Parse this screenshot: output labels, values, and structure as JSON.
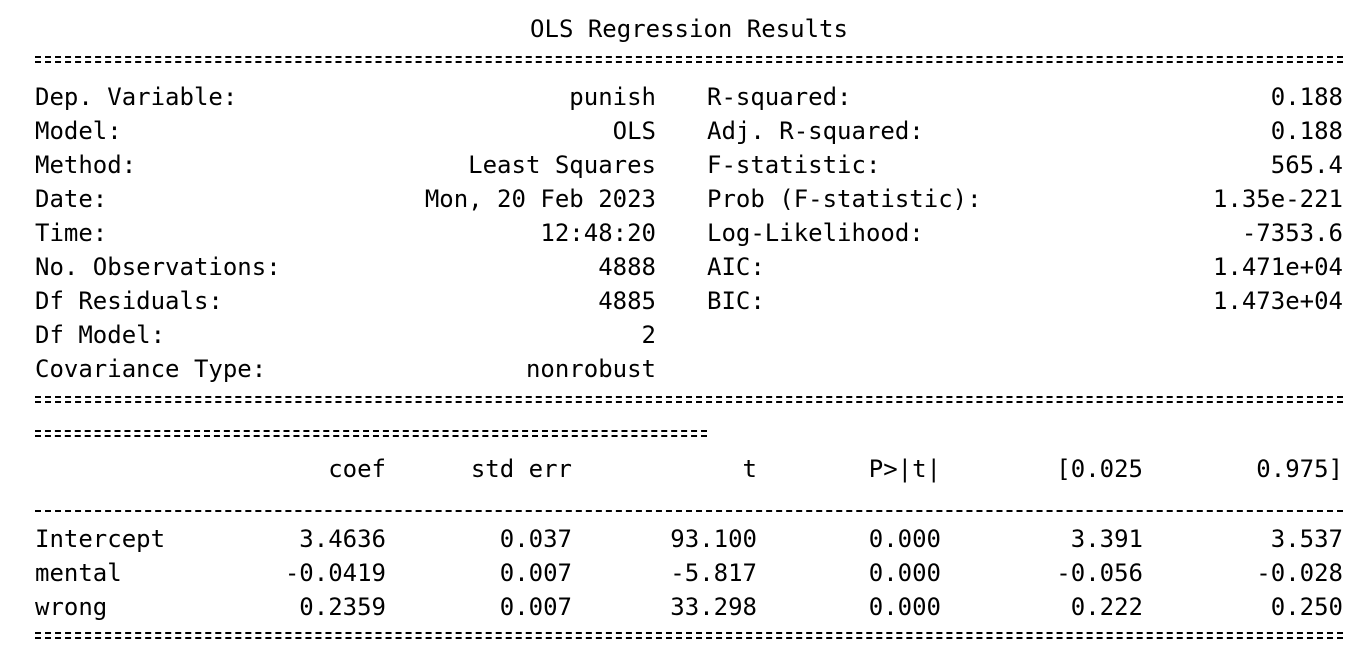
{
  "title": "OLS Regression Results",
  "summary_left": [
    {
      "label": "Dep. Variable:",
      "value": "punish"
    },
    {
      "label": "Model:",
      "value": "OLS"
    },
    {
      "label": "Method:",
      "value": "Least Squares"
    },
    {
      "label": "Date:",
      "value": "Mon, 20 Feb 2023"
    },
    {
      "label": "Time:",
      "value": "12:48:20"
    },
    {
      "label": "No. Observations:",
      "value": "4888"
    },
    {
      "label": "Df Residuals:",
      "value": "4885"
    },
    {
      "label": "Df Model:",
      "value": "2"
    },
    {
      "label": "Covariance Type:",
      "value": "nonrobust"
    }
  ],
  "summary_right": [
    {
      "label": "R-squared:",
      "value": "0.188"
    },
    {
      "label": "Adj. R-squared:",
      "value": "0.188"
    },
    {
      "label": "F-statistic:",
      "value": "565.4"
    },
    {
      "label": "Prob (F-statistic):",
      "value": "1.35e-221"
    },
    {
      "label": "Log-Likelihood:",
      "value": "-7353.6"
    },
    {
      "label": "AIC:",
      "value": "1.471e+04"
    },
    {
      "label": "BIC:",
      "value": "1.473e+04"
    }
  ],
  "coef_table": {
    "headers": [
      "coef",
      "std err",
      "t",
      "P>|t|",
      "[0.025",
      "0.975]"
    ],
    "rows": [
      {
        "name": "Intercept",
        "values": [
          "3.4636",
          "0.037",
          "93.100",
          "0.000",
          "3.391",
          "3.537"
        ]
      },
      {
        "name": "mental",
        "values": [
          "-0.0419",
          "0.007",
          "-5.817",
          "0.000",
          "-0.056",
          "-0.028"
        ]
      },
      {
        "name": "wrong",
        "values": [
          "0.2359",
          "0.007",
          "33.298",
          "0.000",
          "0.222",
          "0.250"
        ]
      }
    ]
  }
}
